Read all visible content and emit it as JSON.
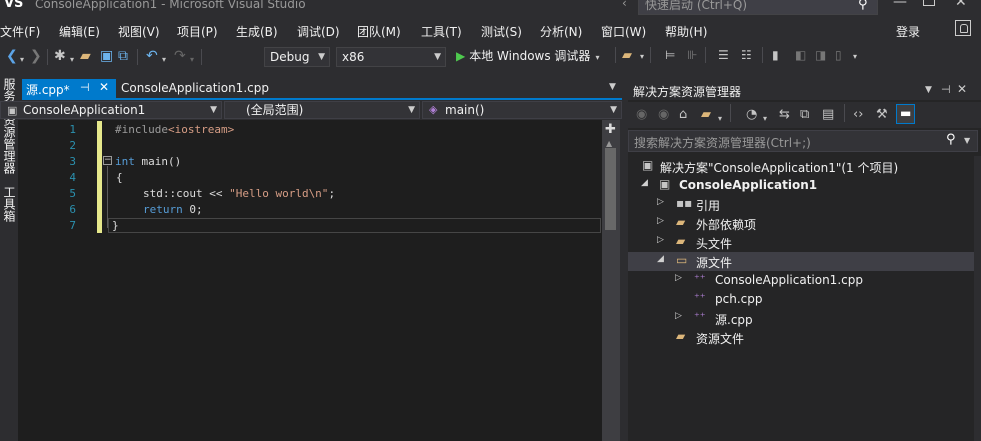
{
  "title_bar": {
    "logo": "VS",
    "title": "ConsoleApplication1 - Microsoft Visual Studio",
    "quick_launch_placeholder": "快速启动 (Ctrl+Q)"
  },
  "menu": {
    "items": [
      "文件(F)",
      "编辑(E)",
      "视图(V)",
      "项目(P)",
      "生成(B)",
      "调试(D)",
      "团队(M)",
      "工具(T)",
      "测试(S)",
      "分析(N)",
      "窗口(W)",
      "帮助(H)"
    ],
    "login": "登录"
  },
  "toolbar": {
    "config": "Debug",
    "platform": "x86",
    "run_label": "本地 Windows 调试器"
  },
  "left_strip": {
    "server_explorer": "服务器资源管理器",
    "toolbox": "工具箱"
  },
  "editor": {
    "tabs": [
      {
        "label": "源.cpp*",
        "active": true
      },
      {
        "label": "ConsoleApplication1.cpp",
        "active": false
      }
    ],
    "nav": {
      "project": "ConsoleApplication1",
      "scope": "(全局范围)",
      "member": "main()"
    },
    "line_numbers": [
      "1",
      "2",
      "3",
      "4",
      "5",
      "6",
      "7"
    ],
    "code": {
      "line1_pp": "#include",
      "line1_inc": "<iostream>",
      "line3_kw": "int",
      "line3_rest": " main()",
      "line4": "{",
      "line5_a": "std::cout << ",
      "line5_str": "\"Hello world\\n\"",
      "line5_b": ";",
      "line6_kw": "return",
      "line6_rest": " 0;",
      "line7": "}"
    }
  },
  "solution_explorer": {
    "title": "解决方案资源管理器",
    "search_placeholder": "搜索解决方案资源管理器(Ctrl+;)",
    "tree": [
      {
        "label": "解决方案\"ConsoleApplication1\"(1 个项目)",
        "expander": ""
      },
      {
        "label": "ConsoleApplication1",
        "expander": "◢",
        "bold": true
      },
      {
        "label": "引用",
        "expander": "▷"
      },
      {
        "label": "外部依赖项",
        "expander": "▷"
      },
      {
        "label": "头文件",
        "expander": "▷"
      },
      {
        "label": "源文件",
        "expander": "◢",
        "selected": true
      },
      {
        "label": "ConsoleApplication1.cpp",
        "expander": "▷"
      },
      {
        "label": "pch.cpp",
        "expander": ""
      },
      {
        "label": "源.cpp",
        "expander": "▷"
      },
      {
        "label": "资源文件",
        "expander": ""
      }
    ]
  }
}
